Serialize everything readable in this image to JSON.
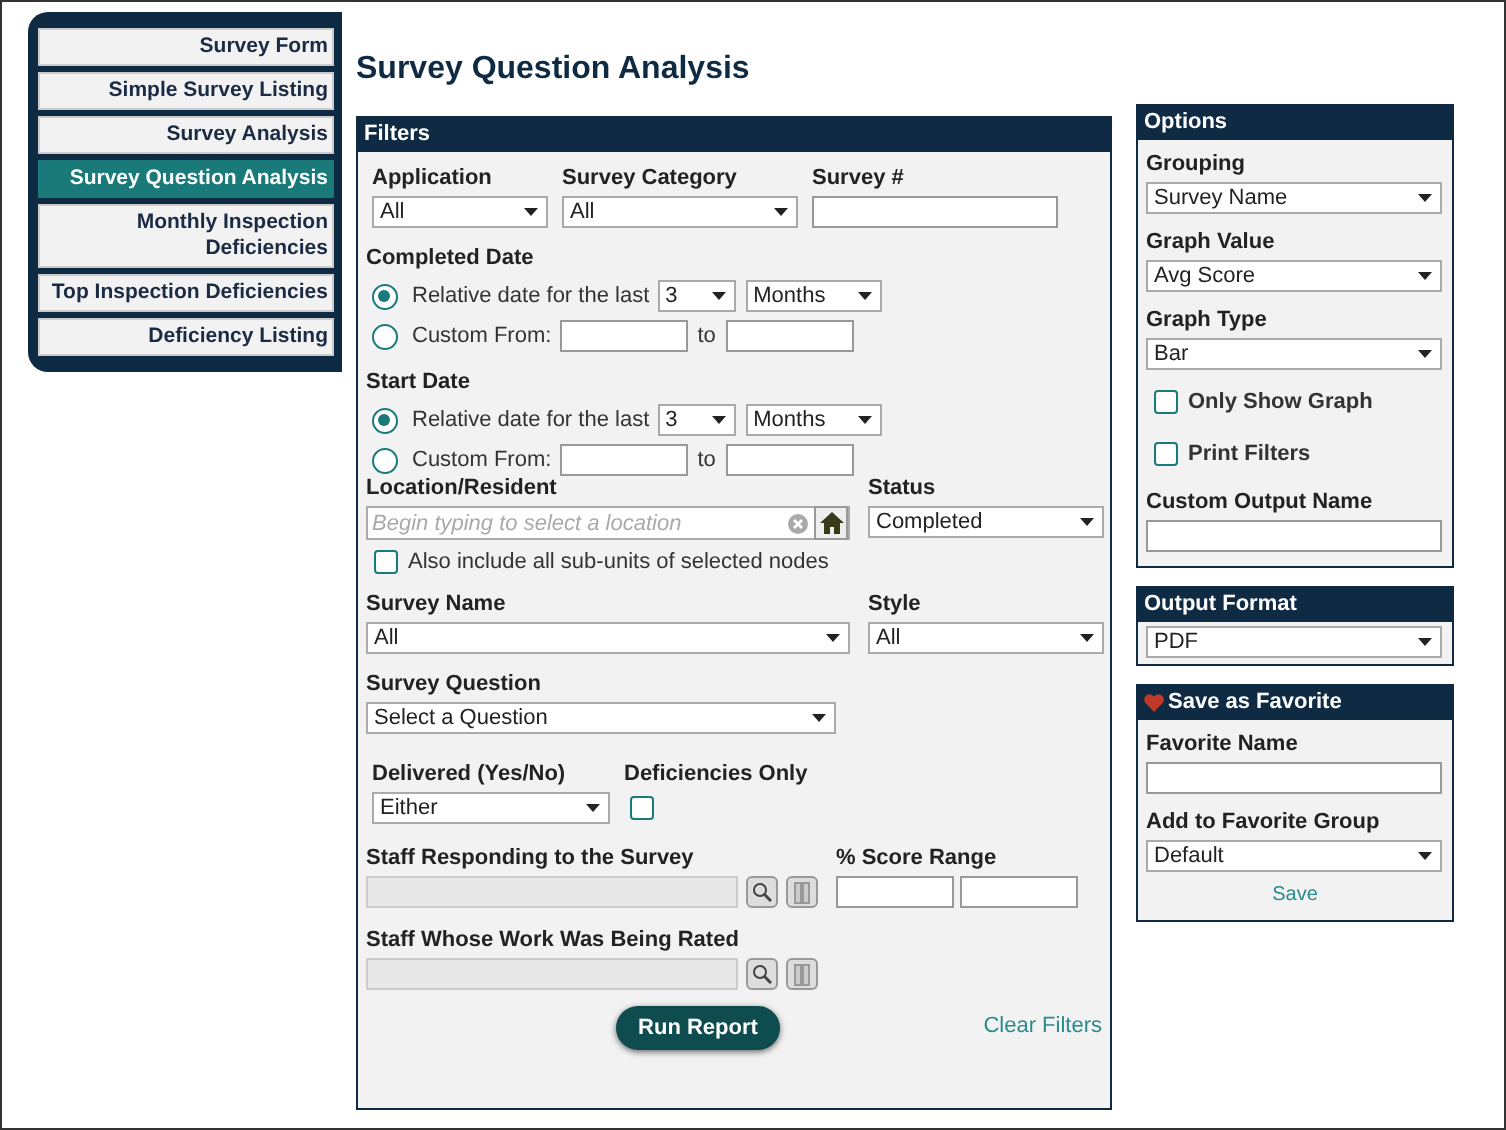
{
  "sidebar": {
    "items": [
      {
        "label": "Survey Form",
        "selected": false
      },
      {
        "label": "Simple Survey Listing",
        "selected": false
      },
      {
        "label": "Survey Analysis",
        "selected": false
      },
      {
        "label": "Survey Question Analysis",
        "selected": true
      },
      {
        "label": "Monthly Inspection Deficiencies",
        "selected": false
      },
      {
        "label": "Top Inspection Deficiencies",
        "selected": false
      },
      {
        "label": "Deficiency Listing",
        "selected": false
      }
    ]
  },
  "title": "Survey Question Analysis",
  "filters": {
    "header": "Filters",
    "application": {
      "label": "Application",
      "value": "All"
    },
    "survey_category": {
      "label": "Survey Category",
      "value": "All"
    },
    "survey_number": {
      "label": "Survey #"
    },
    "date_groups": [
      {
        "label": "Completed Date",
        "relative": {
          "label": "Relative date for the last",
          "selected": true,
          "count": "3",
          "unit": "Months"
        },
        "custom": {
          "label": "Custom From:",
          "selected": false,
          "to": "to"
        }
      },
      {
        "label": "Start Date",
        "relative": {
          "label": "Relative date for the last",
          "selected": true,
          "count": "3",
          "unit": "Months"
        },
        "custom": {
          "label": "Custom From:",
          "selected": false,
          "to": "to"
        }
      }
    ],
    "location": {
      "label": "Location/Resident",
      "placeholder": "Begin typing to select a location"
    },
    "include_subunits": {
      "label": "Also include all sub-units of selected nodes",
      "checked": false
    },
    "status": {
      "label": "Status",
      "value": "Completed"
    },
    "survey_name": {
      "label": "Survey Name",
      "value": "All"
    },
    "style": {
      "label": "Style",
      "value": "All"
    },
    "survey_question": {
      "label": "Survey Question",
      "value": "Select a Question"
    },
    "delivered": {
      "label": "Delivered (Yes/No)",
      "value": "Either"
    },
    "deficiencies_only": {
      "label": "Deficiencies Only",
      "checked": false
    },
    "staff_responding": {
      "label": "Staff Responding to the Survey",
      "disabled": true
    },
    "score_range": {
      "label": "% Score Range"
    },
    "staff_rated": {
      "label": "Staff Whose Work Was Being Rated",
      "disabled": true
    },
    "run_button": "Run Report",
    "clear_link": "Clear Filters"
  },
  "options": {
    "header": "Options",
    "grouping": {
      "label": "Grouping",
      "value": "Survey Name"
    },
    "graph_value": {
      "label": "Graph Value",
      "value": "Avg Score"
    },
    "graph_type": {
      "label": "Graph Type",
      "value": "Bar"
    },
    "only_show_graph": {
      "label": "Only Show Graph",
      "checked": false
    },
    "print_filters": {
      "label": "Print Filters",
      "checked": false
    },
    "custom_output_name": {
      "label": "Custom Output Name"
    }
  },
  "output_format": {
    "header": "Output Format",
    "value": "PDF"
  },
  "favorite": {
    "header": "Save as Favorite",
    "favorite_name": {
      "label": "Favorite Name"
    },
    "group": {
      "label": "Add to Favorite Group",
      "value": "Default"
    },
    "save": "Save"
  }
}
